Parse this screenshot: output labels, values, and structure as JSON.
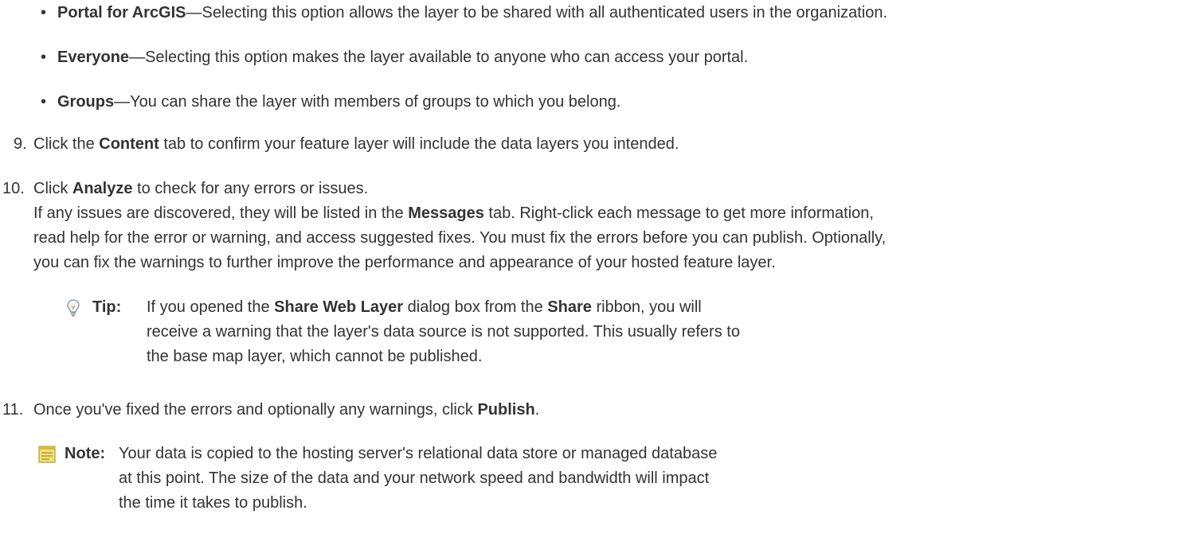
{
  "bullets": [
    {
      "bold": "Portal for ArcGIS",
      "rest": "—Selecting this option allows the layer to be shared with all authenticated users in the organization."
    },
    {
      "bold": "Everyone",
      "rest": "—Selecting this option makes the layer available to anyone who can access your portal."
    },
    {
      "bold": "Groups",
      "rest": "—You can share the layer with members of groups to which you belong."
    }
  ],
  "step9": {
    "number": "9.",
    "pre": "Click the ",
    "bold": "Content",
    "post": " tab to confirm your feature layer will include the data layers you intended."
  },
  "step10": {
    "number": "10.",
    "pre": "Click ",
    "bold": "Analyze",
    "post": " to check for any errors or issues.",
    "para_pre": "If any issues are discovered, they will be listed in the ",
    "para_bold": "Messages",
    "para_post": " tab. Right-click each message to get more information,",
    "para_line2": "read help for the error or warning, and access suggested fixes. You must fix the errors before you can publish. Optionally,",
    "para_line3": "you can fix the warnings to further improve the performance and appearance of your hosted feature layer."
  },
  "tip": {
    "icon": "lightbulb-icon",
    "label": "Tip:",
    "l1_pre": "If you opened the ",
    "l1_bold1": "Share Web Layer",
    "l1_mid": " dialog box from the ",
    "l1_bold2": "Share",
    "l1_post": " ribbon, you will",
    "l2": "receive a warning that the layer's data source is not supported. This usually refers to",
    "l3": "the base map layer, which cannot be published."
  },
  "step11": {
    "number": "11.",
    "pre": "Once you've fixed the errors and optionally any warnings, click ",
    "bold": "Publish",
    "post": "."
  },
  "note": {
    "icon": "note-icon",
    "label": "Note:",
    "l1": "Your data is copied to the hosting server's relational data store or managed database",
    "l2": "at this point. The size of the data and your network speed and bandwidth will impact",
    "l3": "the time it takes to publish."
  },
  "colors": {
    "text": "#333333",
    "note_icon": "#e8d56a",
    "tip_icon": "#9aa6b2"
  }
}
